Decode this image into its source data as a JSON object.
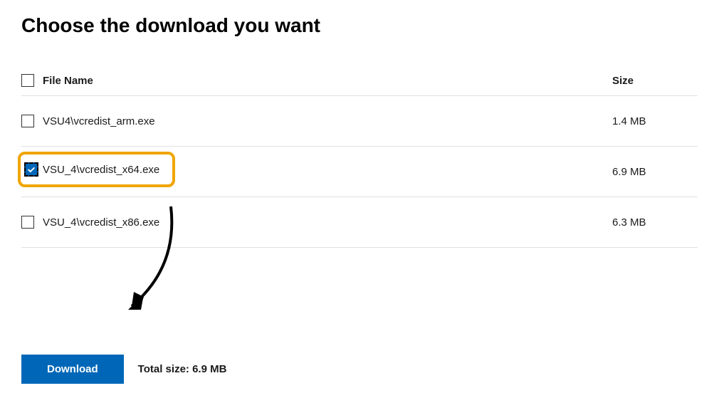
{
  "page": {
    "title": "Choose the download you want"
  },
  "table": {
    "header": {
      "filename_label": "File Name",
      "size_label": "Size"
    },
    "rows": [
      {
        "filename": "VSU4\\vcredist_arm.exe",
        "size": "1.4 MB",
        "checked": false,
        "highlighted": false
      },
      {
        "filename": "VSU_4\\vcredist_x64.exe",
        "size": "6.9 MB",
        "checked": true,
        "highlighted": true
      },
      {
        "filename": "VSU_4\\vcredist_x86.exe",
        "size": "6.3 MB",
        "checked": false,
        "highlighted": false
      }
    ]
  },
  "footer": {
    "download_label": "Download",
    "total_size_label": "Total size: 6.9 MB"
  }
}
